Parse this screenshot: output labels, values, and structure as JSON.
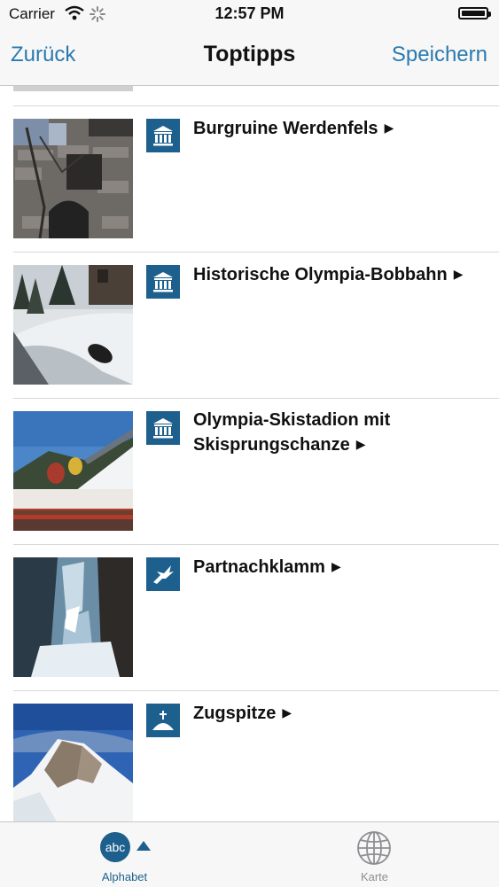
{
  "status_bar": {
    "carrier": "Carrier",
    "time": "12:57 PM",
    "icons": [
      "wifi-icon",
      "activity-spinner-icon",
      "battery-icon"
    ]
  },
  "nav": {
    "back_label": "Zurück",
    "title": "Toptipps",
    "save_label": "Speichern"
  },
  "items": [
    {
      "title": "Burgruine Werdenfels",
      "arrow": "▶",
      "category_icon": "museum-icon",
      "photo": "castle-ruin-wall"
    },
    {
      "title": "Historische Olympia-Bobbahn",
      "arrow": "▶",
      "category_icon": "museum-icon",
      "photo": "bobsled-track"
    },
    {
      "title": "Olympia-Skistadion mit Skisprungschanze",
      "arrow": "▶",
      "category_icon": "museum-icon",
      "photo": "ski-stadium-jump"
    },
    {
      "title": "Partnachklamm",
      "arrow": "▶",
      "category_icon": "eagle-icon",
      "photo": "gorge-ice"
    },
    {
      "title": "Zugspitze",
      "arrow": "▶",
      "category_icon": "summit-icon",
      "photo": "mountain-peak"
    }
  ],
  "tabbar": {
    "alphabet": {
      "label": "Alphabet",
      "icon_text": "abc",
      "active": true,
      "color": "#1d5f8d"
    },
    "map": {
      "label": "Karte",
      "icon": "globe-icon",
      "color": "#8e8e93"
    }
  },
  "colors": {
    "accent": "#2a7ab0",
    "category_badge": "#1d5f8d",
    "bar_background": "#f7f7f7"
  }
}
